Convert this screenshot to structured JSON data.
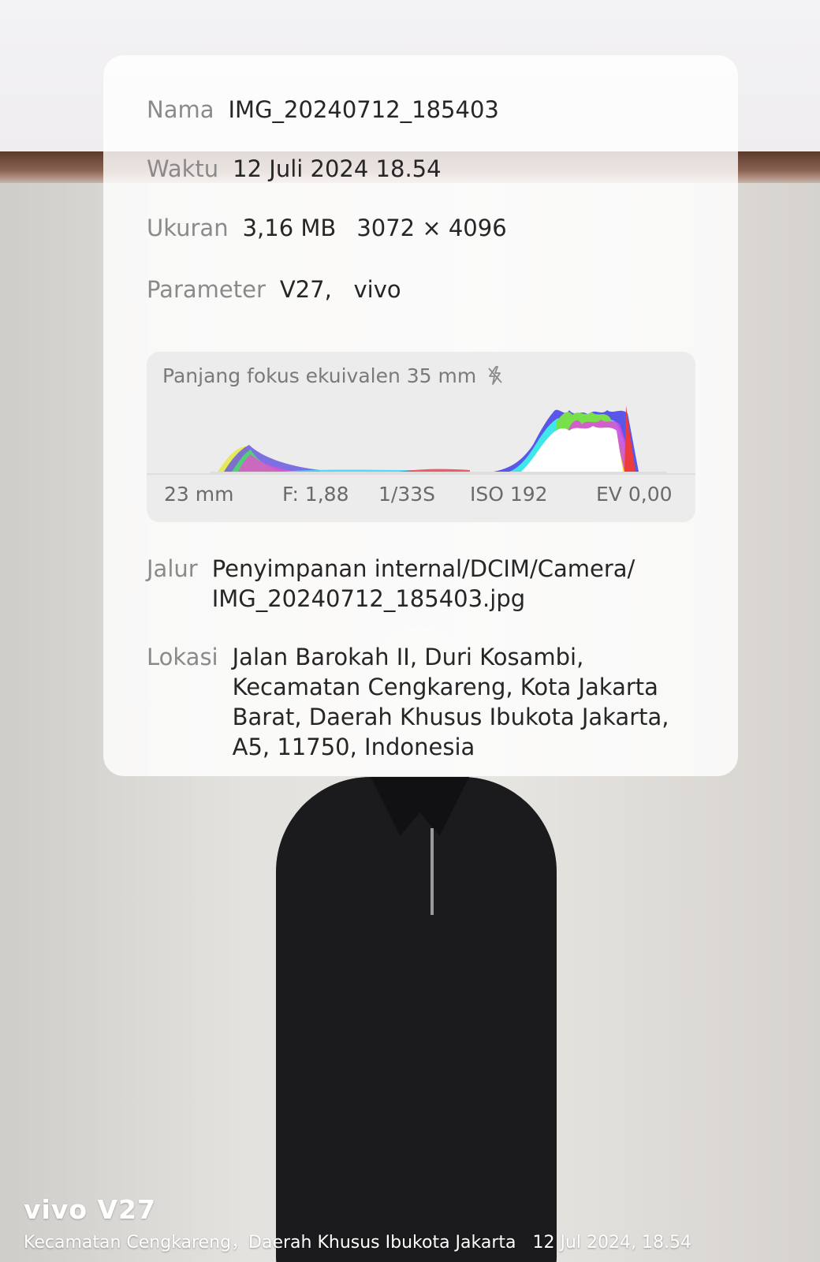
{
  "info": {
    "name": {
      "label": "Nama",
      "value": "IMG_20240712_185403"
    },
    "time": {
      "label": "Waktu",
      "value": "12 Juli 2024 18.54"
    },
    "size": {
      "label": "Ukuran",
      "file_size": "3,16 MB",
      "dimensions": "3072 × 4096"
    },
    "parameter": {
      "label": "Parameter",
      "value": "V27,   vivo"
    },
    "histogram": {
      "title": "Panjang fokus ekuivalen 35 mm",
      "flash_icon": "flash-off-icon",
      "focal_length": "23 mm",
      "aperture": "F: 1,88",
      "shutter": "1/33S",
      "iso": "ISO 192",
      "ev": "EV 0,00"
    },
    "path": {
      "label": "Jalur",
      "lines": [
        "Penyimpanan internal/DCIM/Camera/",
        "IMG_20240712_185403.jpg"
      ]
    },
    "location": {
      "label": "Lokasi",
      "lines": [
        "Jalan Barokah II, Duri Kosambi,",
        "Kecamatan Cengkareng, Kota Jakarta",
        "Barat, Daerah Khusus Ibukota Jakarta,",
        "A5, 11750, Indonesia"
      ]
    }
  },
  "watermark": {
    "brand": "vivo V27",
    "caption": "Kecamatan Cengkareng，Daerah Khusus Ibukota Jakarta   12 Jul 2024, 18.54"
  },
  "colors": {
    "card_bg": "#ffffff",
    "label": "#8a8a8a",
    "value": "#262626",
    "histogram_bg": "#ececec"
  }
}
